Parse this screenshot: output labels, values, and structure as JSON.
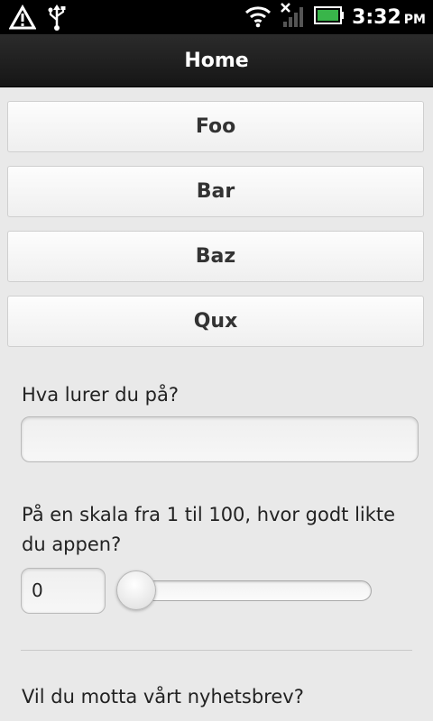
{
  "status_bar": {
    "time": "3:32",
    "ampm": "PM",
    "icons": [
      "warning-icon",
      "usb-icon",
      "wifi-icon",
      "signal-icon",
      "battery-icon"
    ],
    "battery_color": "#39b54a"
  },
  "header": {
    "title": "Home"
  },
  "buttons": [
    "Foo",
    "Bar",
    "Baz",
    "Qux"
  ],
  "form": {
    "question1": "Hva lurer du på?",
    "question1_value": "",
    "question2_line1": "På en skala fra 1 til 100, hvor godt likte",
    "question2_line2": "du appen?",
    "rating_value": "0",
    "rating_slider_fraction": 0,
    "question3": "Vil du motta vårt nyhetsbrev?"
  }
}
